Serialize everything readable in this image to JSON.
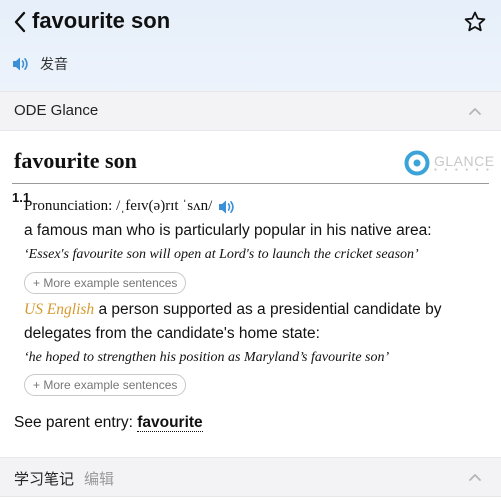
{
  "header": {
    "title": "favourite son",
    "audio_label": "发音"
  },
  "ode_section": {
    "label": "ODE Glance"
  },
  "entry": {
    "headword": "favourite son",
    "logo_text": "GLANCE",
    "logo_dots": "● ● ● ● ● ●",
    "sense_number": "1.1",
    "pronunciation": "Pronunciation: /ˌfeɪv(ə)rɪt ˈsʌn/",
    "definition_1": "a famous man who is particularly popular in his native area:",
    "example_1": "‘Essex's favourite son will open at Lord's to launch the cricket season’",
    "more_examples_label": "+ More example sentences",
    "usage_label": "US English",
    "definition_2_line1": " a person supported as a presidential candidate by",
    "definition_2_line2": "delegates from the candidate's home state:",
    "example_2": "‘he hoped to strengthen his position as Maryland’s favourite son’",
    "parent_prefix": "See parent entry: ",
    "parent_link": "favourite"
  },
  "notes_section": {
    "label": "学习笔记",
    "edit_label": "编辑"
  },
  "colors": {
    "accent_blue": "#3b8fd6",
    "usage_orange": "#d69a2e"
  }
}
